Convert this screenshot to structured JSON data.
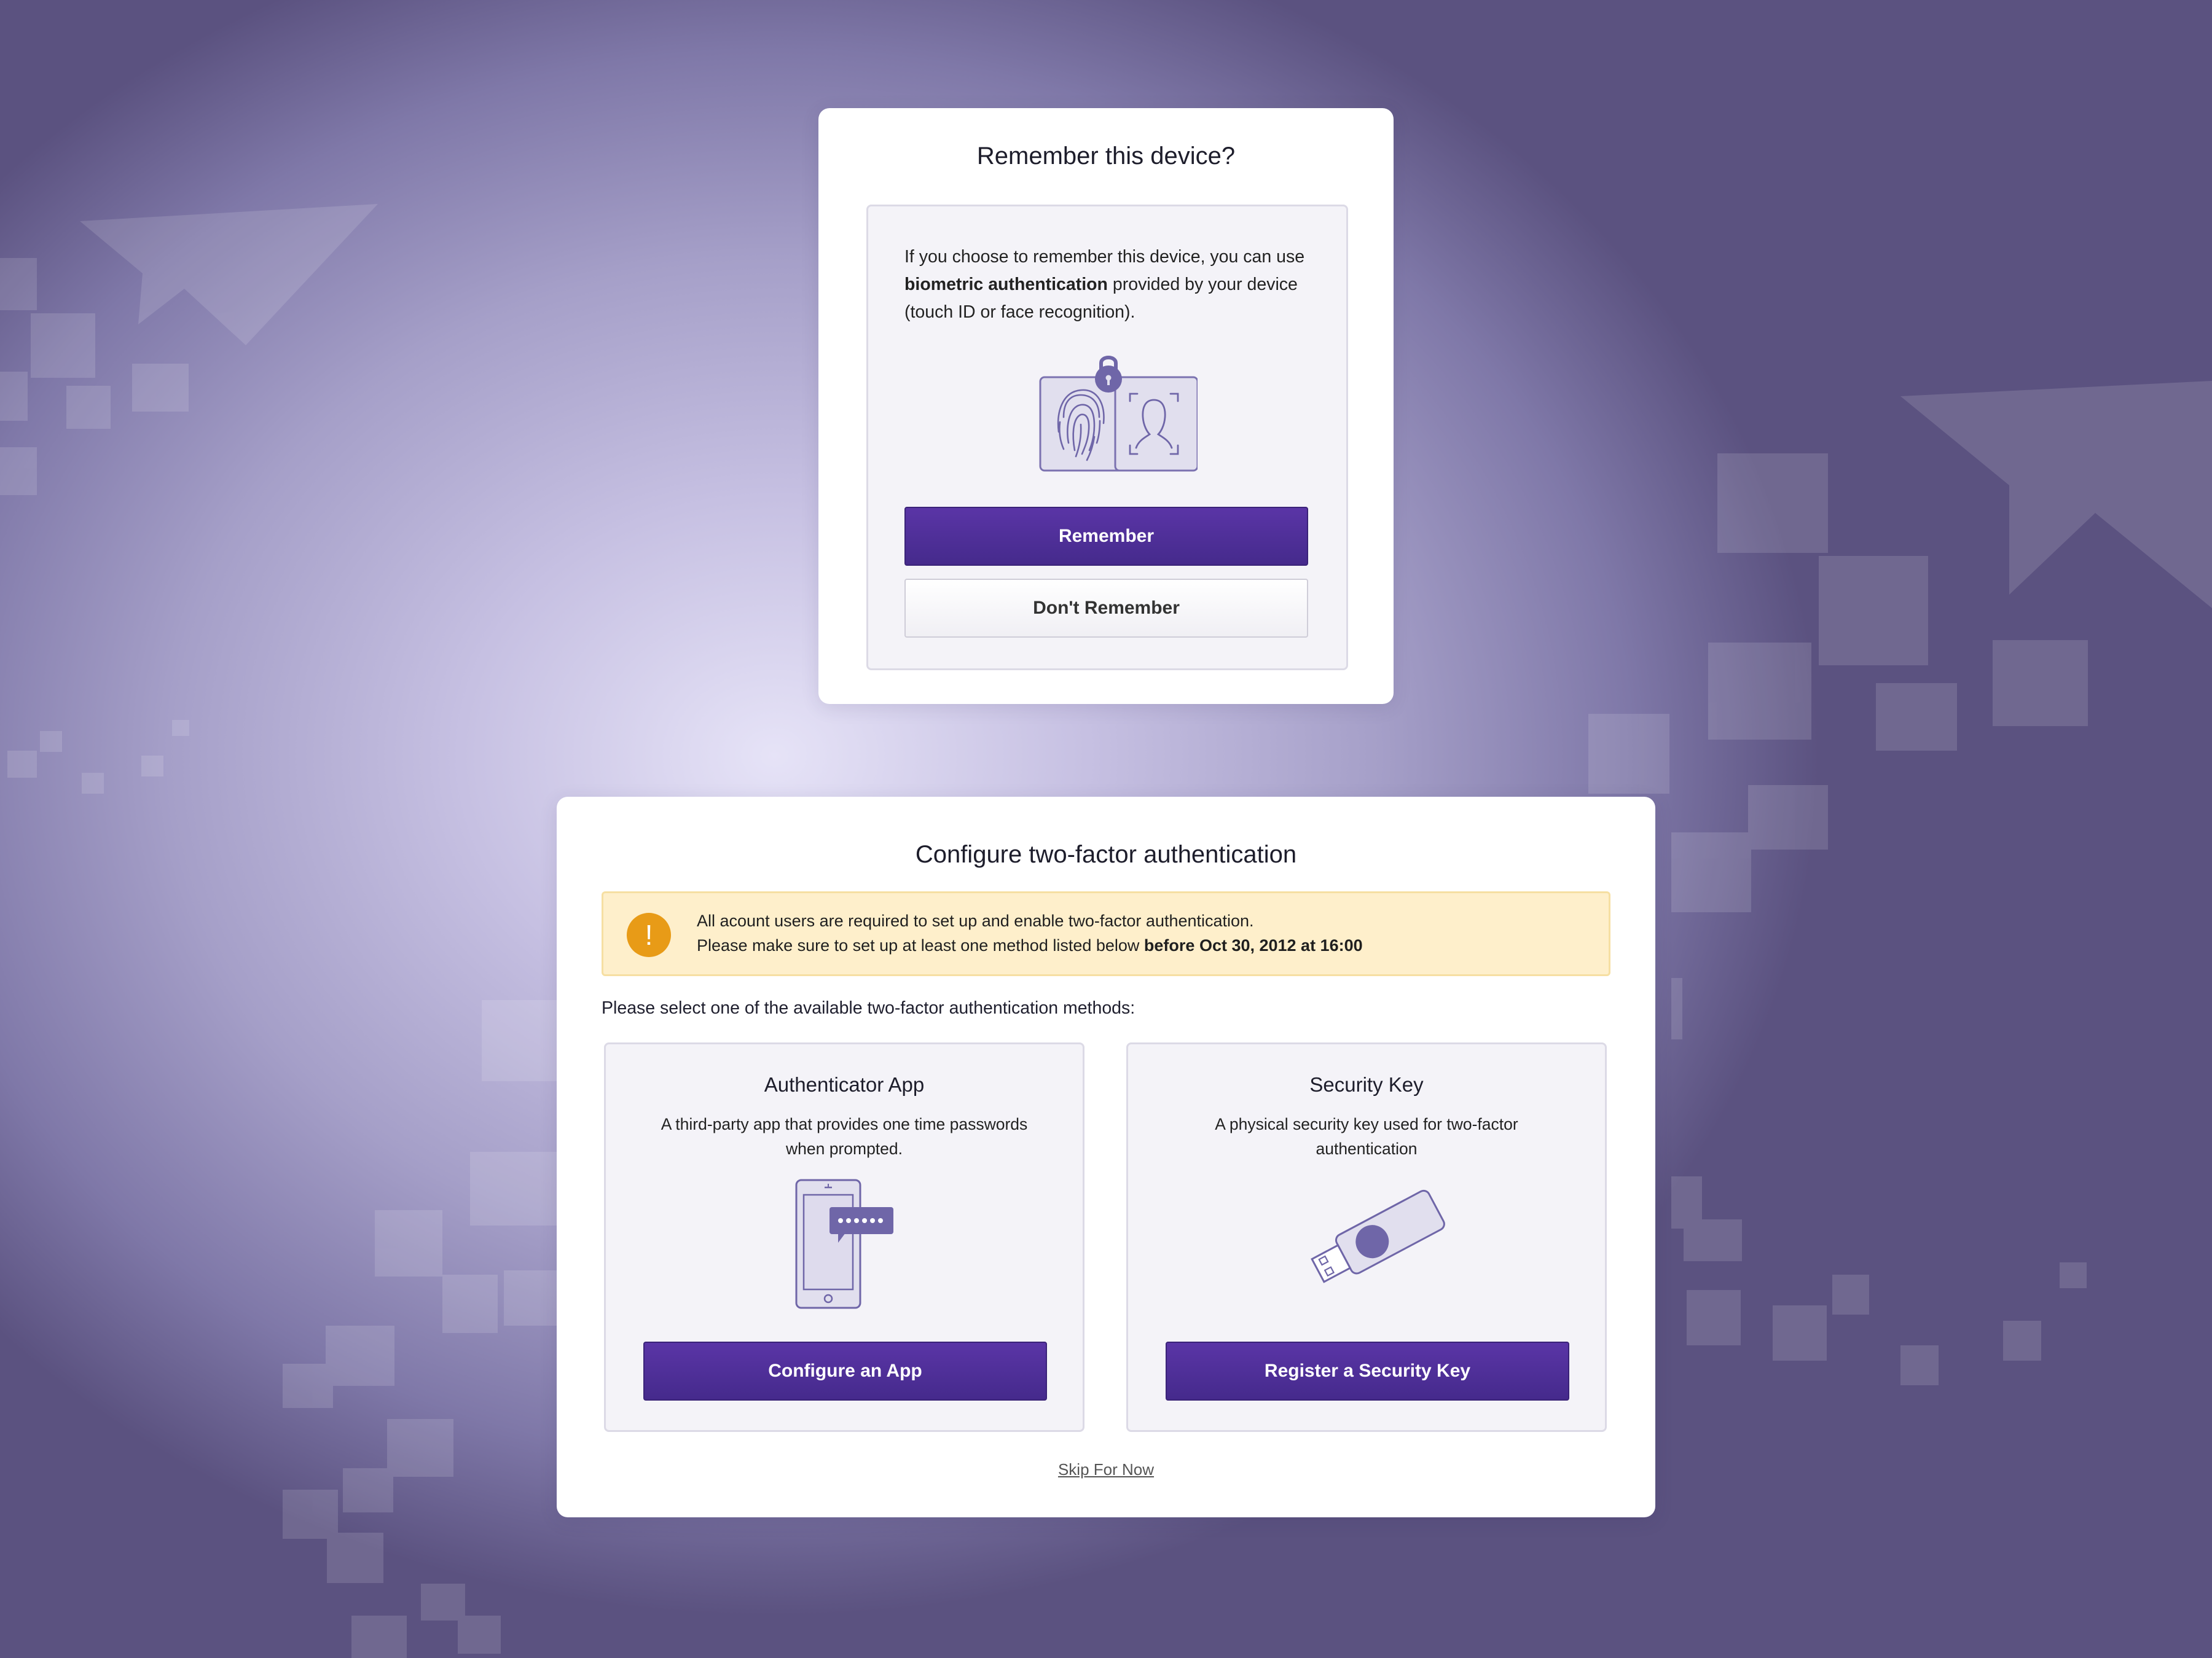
{
  "remember_card": {
    "title": "Remember this device?",
    "text_before": "If you choose to remember this device, you can use ",
    "text_bold": "biometric authentication",
    "text_after": " provided by your device (touch ID or face recognition).",
    "illustration_icons": [
      "fingerprint-icon",
      "padlock-icon",
      "face-recognition-icon"
    ],
    "remember_label": "Remember",
    "dont_remember_label": "Don't Remember"
  },
  "twofa_card": {
    "title": "Configure two-factor authentication",
    "warning": {
      "icon": "exclamation-icon",
      "line1": "All acount users are required to set up and enable two-factor authentication.",
      "line2_before": "Please make sure to set up at least one method listed below ",
      "line2_bold": "before Oct 30, 2012 at 16:00"
    },
    "select_text": "Please select one of the available two-factor authentication methods:",
    "methods": [
      {
        "title": "Authenticator App",
        "description": "A third-party app that provides one time passwords when prompted.",
        "icon": "smartphone-otp-icon",
        "button_label": "Configure an App"
      },
      {
        "title": "Security Key",
        "description": "A physical security key used for two-factor authentication",
        "icon": "usb-security-key-icon",
        "button_label": "Register a Security Key"
      }
    ],
    "skip_label": "Skip For Now"
  },
  "colors": {
    "primary": "#4b2d93",
    "warning_bg": "#feefcb",
    "warning_icon": "#e89b17",
    "illustration": "#6f66a8"
  }
}
